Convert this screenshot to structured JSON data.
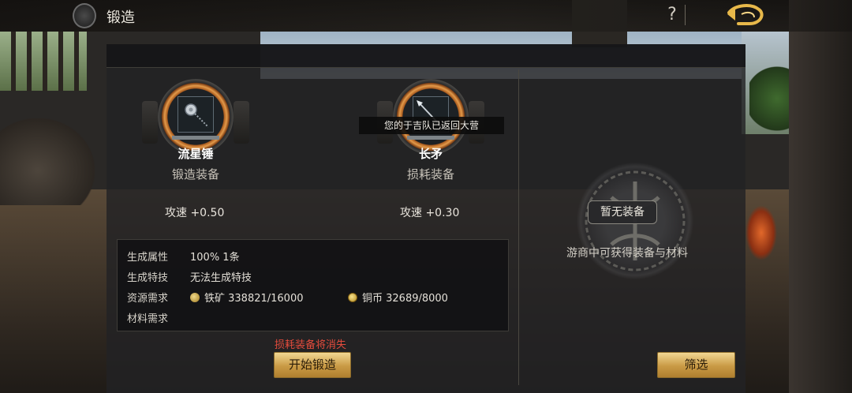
{
  "header": {
    "title": "锻造",
    "help_label": "?"
  },
  "slots": {
    "forge": {
      "name": "流星锤",
      "role": "锻造装备",
      "stat": "攻速 +0.50"
    },
    "consume": {
      "name": "长矛",
      "role": "损耗装备",
      "stat": "攻速 +0.30",
      "tooltip": "您的于吉队已返回大营"
    }
  },
  "info": {
    "rows": [
      {
        "label": "生成属性",
        "value": "100% 1条"
      },
      {
        "label": "生成特技",
        "value": "无法生成特技"
      },
      {
        "label": "资源需求",
        "ore": "铁矿 338821/16000",
        "coin": "铜币 32689/8000"
      },
      {
        "label": "材料需求",
        "value": ""
      }
    ]
  },
  "warning": "损耗装备将消失",
  "start_button": "开始锻造",
  "right_panel": {
    "empty_label": "暂无装备",
    "hint": "游商中可获得装备与材料",
    "filter_button": "筛选"
  },
  "colors": {
    "accent_gold": "#c99a45",
    "warning_red": "#e34b3c",
    "ring_orange": "#e39a4a"
  },
  "icons": [
    "dragon-logo-icon",
    "help-icon",
    "back-arrow-icon",
    "meteor-hammer-icon",
    "spear-icon",
    "iron-ore-icon",
    "copper-coin-icon",
    "emblem-icon"
  ]
}
